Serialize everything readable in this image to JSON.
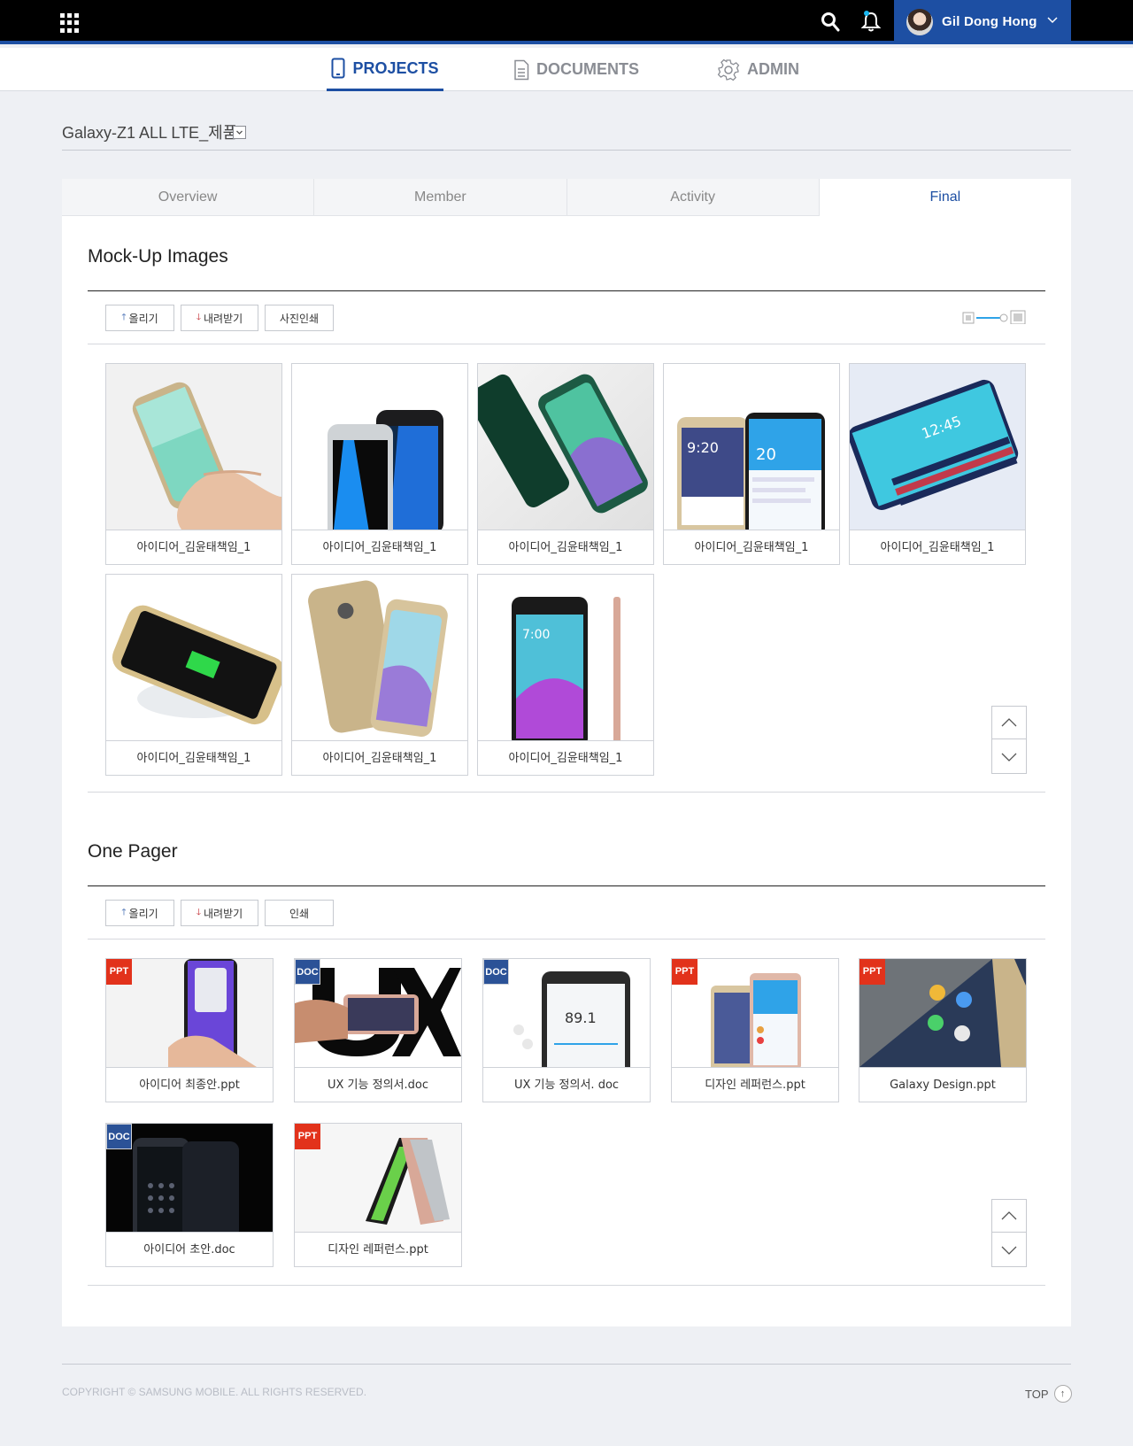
{
  "header": {
    "user_name": "Gil Dong Hong",
    "accent": "#1d4fa3"
  },
  "nav": {
    "items": [
      {
        "label": "PROJECTS",
        "icon": "phone-icon",
        "active": true
      },
      {
        "label": "DOCUMENTS",
        "icon": "document-icon",
        "active": false
      },
      {
        "label": "ADMIN",
        "icon": "gear-icon",
        "active": false
      }
    ]
  },
  "project": {
    "title": "Galaxy-Z1 ALL LTE_제품"
  },
  "tabs": [
    {
      "label": "Overview"
    },
    {
      "label": "Member"
    },
    {
      "label": "Activity"
    },
    {
      "label": "Final",
      "active": true
    }
  ],
  "mockup": {
    "title": "Mock-Up Images",
    "buttons": {
      "upload": "올리기",
      "download": "내려받기",
      "print": "사진인쇄"
    },
    "images": [
      {
        "caption": "아이디어_김윤태책임_1",
        "icon": "hand-phone-image"
      },
      {
        "caption": "아이디어_김윤태책임_1",
        "icon": "two-phones-image"
      },
      {
        "caption": "아이디어_김윤태책임_1",
        "icon": "edge-phones-image"
      },
      {
        "caption": "아이디어_김윤태책임_1",
        "icon": "screen-phones-image"
      },
      {
        "caption": "아이디어_김윤태책임_1",
        "icon": "edge-screen-image"
      },
      {
        "caption": "아이디어_김윤태책임_1",
        "icon": "wireless-charger-image"
      },
      {
        "caption": "아이디어_김윤태책임_1",
        "icon": "gold-phones-image"
      },
      {
        "caption": "아이디어_김윤태책임_1",
        "icon": "galaxy-a-image"
      }
    ]
  },
  "onepager": {
    "title": "One Pager",
    "buttons": {
      "upload": "올리기",
      "download": "내려받기",
      "print": "인쇄"
    },
    "docs": [
      {
        "caption": "아이디어 최종안.ppt",
        "type": "PPT"
      },
      {
        "caption": "UX 기능 정의서.doc",
        "type": "DOC"
      },
      {
        "caption": "UX 기능 정의서. doc",
        "type": "DOC"
      },
      {
        "caption": "디자인 레퍼런스.ppt",
        "type": "PPT"
      },
      {
        "caption": "Galaxy Design.ppt",
        "type": "PPT"
      },
      {
        "caption": "아이디어 초안.doc",
        "type": "DOC"
      },
      {
        "caption": "디자인 레퍼런스.ppt",
        "type": "PPT"
      }
    ]
  },
  "footer": {
    "copyright": "COPYRIGHT © SAMSUNG MOBILE. ALL RIGHTS RESERVED.",
    "top_label": "TOP"
  }
}
